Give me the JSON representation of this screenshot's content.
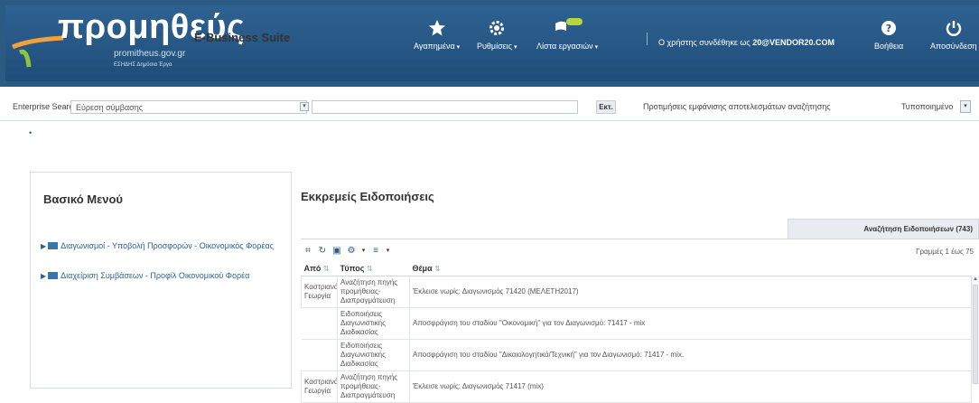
{
  "header": {
    "logo_main": "προμηθεύς",
    "logo_suffix": "E-Business Suite",
    "logo_url": "promitheus.gov.gr",
    "logo_sub": "ΕΣΗΔΗΣ Δημόσια Έργα",
    "nav": {
      "favorites": "Αγαπημένα",
      "settings": "Ρυθμίσεις",
      "worklist": "Λίστα εργασιών"
    },
    "user_prefix": "Ο χρήστης συνδέθηκε ως",
    "user_name": "20@VENDOR20.COM",
    "help": "Βοήθεια",
    "logout": "Αποσύνδεση"
  },
  "search": {
    "label": "Enterprise Search",
    "scope": "Εύρεση σύμβασης",
    "go": "Εκτ.",
    "prefs_label": "Προτιμήσεις εμφάνισης αποτελεσμάτων αναζήτησης",
    "prefs_value": "Τυποποιημένο"
  },
  "left_menu": {
    "title": "Βασικό Μενού",
    "items": [
      {
        "label": "Διαγωνισμοί - Υποβολή Προσφορών - Οικονομικός Φορέας"
      },
      {
        "label": "Διαχείριση Συμβάσεων - Προφίλ Οικονομικού Φορέα"
      }
    ]
  },
  "notifications": {
    "title": "Εκκρεμείς Ειδοποιήσεις",
    "search_tab": "Αναζήτηση Ειδοποιήσεων (743)",
    "rows_label": "Γραμμές 1 έως 75",
    "columns": {
      "from": "Από",
      "type": "Τύπος",
      "subject": "Θέμα"
    },
    "rows": [
      {
        "from": "Καστριανά Γεωργία",
        "type": "Αναζήτηση πηγής προμήθειας-Διαπραγμάτευση",
        "subject": "Έκλεισε νωρίς: Διαγωνισμός 71420 (ΜΕΛΕΤΗ2017)"
      },
      {
        "from": "",
        "type": "Ειδοποιήσεις Διαγωνιστικής Διαδικασίας",
        "subject": "Αποσφράγιση του σταδίου \"Οικονομική\" για τον Διαγωνισμό: 71417 - mix"
      },
      {
        "from": "",
        "type": "Ειδοποιήσεις Διαγωνιστικής Διαδικασίας",
        "subject": "Αποσφράγιση του σταδίου \"Δικαιολογητικά/Τεχνική\" για τον Διαγωνισμό: 71417 - mix."
      },
      {
        "from": "Καστριανά Γεωργία",
        "type": "Αναζήτηση πηγής προμήθειας-Διαπραγμάτευση",
        "subject": "Έκλεισε νωρίς: Διαγωνισμός 71417 (mix)"
      }
    ]
  }
}
